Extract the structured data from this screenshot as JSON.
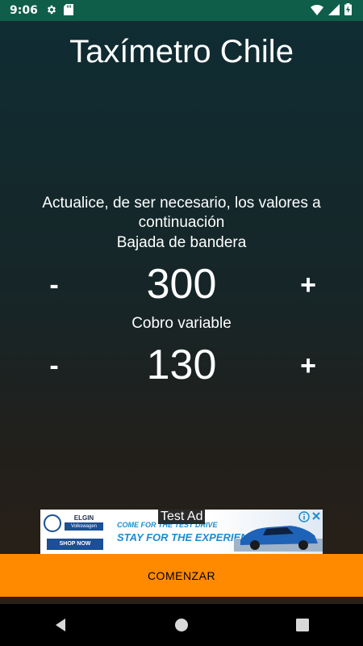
{
  "status_bar": {
    "time": "9:06",
    "icons_left": [
      "settings-icon",
      "sd-card-icon"
    ],
    "icons_right": [
      "wifi-icon",
      "cell-signal-icon",
      "battery-charging-icon"
    ]
  },
  "app": {
    "title": "Taxímetro Chile",
    "instructions": "Actualice, de ser necesario, los valores a continuación",
    "fare_start": {
      "label": "Bajada de bandera",
      "value": "300",
      "decrement": "-",
      "increment": "+"
    },
    "variable_fare": {
      "label": "Cobro variable",
      "value": "130",
      "decrement": "-",
      "increment": "+"
    },
    "start_button": "COMENZAR"
  },
  "ad": {
    "label": "Test Ad",
    "dealer_name": "ELGIN",
    "dealer_brand": "Volkswagen",
    "shop_now": "SHOP NOW",
    "headline_1": "COME FOR THE TEST DRIVE",
    "headline_2": "STAY FOR THE EXPERIENCE"
  },
  "nav_bar": {
    "buttons": [
      "back-icon",
      "home-icon",
      "recents-icon"
    ]
  },
  "colors": {
    "status_bar": "#0f5e4a",
    "accent_button": "#ff8a00",
    "background_top": "#0f2d33",
    "background_bottom": "#2a2016"
  }
}
